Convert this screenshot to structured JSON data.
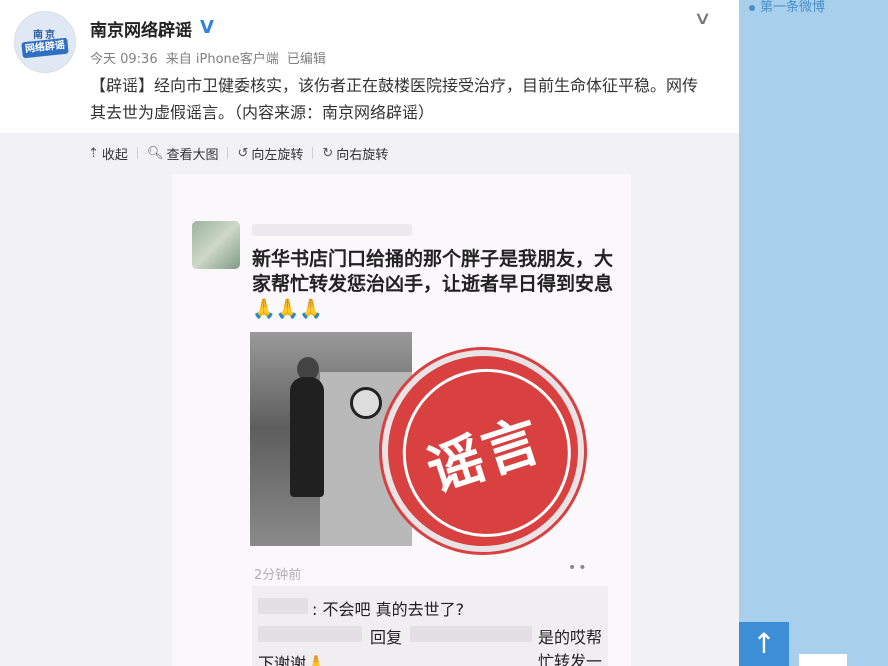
{
  "account": {
    "name": "南京网络辟谣",
    "avatar_text_top": "南京",
    "avatar_text_bottom": "网络辟谣",
    "verified_icon": "V"
  },
  "meta": {
    "time": "今天 09:36",
    "source": "来自 iPhone客户端",
    "edited": "已编辑"
  },
  "post": {
    "text": "【辟谣】经向市卫健委核实，该伤者正在鼓楼医院接受治疗，目前生命体征平稳。网传其去世为虚假谣言。（内容来源：南京网络辟谣）"
  },
  "toolbar": {
    "collapse": "收起",
    "view_large": "查看大图",
    "rotate_left": "向左旋转",
    "rotate_right": "向右旋转"
  },
  "photo": {
    "text": "新华书店门口给捅的那个胖子是我朋友，大家帮忙转发惩治凶手，让逝者早日得到安息",
    "pray": "🙏🙏🙏",
    "stamp": "谣言",
    "time": "2分钟前",
    "more": "••",
    "comment1": ": 不会吧  真的去世了?",
    "comment2_prefix": "回复",
    "comment2_suffix": "是的哎帮忙转发一",
    "comment3": "下谢谢🙏"
  },
  "sidebar": {
    "link": "第一条微博",
    "top_icon": "↑"
  },
  "colors": {
    "sidebar_bg": "#a8d0ec",
    "top_button": "#3c8fd6",
    "stamp_red": "#d94040",
    "verified_blue": "#2f84d8"
  }
}
